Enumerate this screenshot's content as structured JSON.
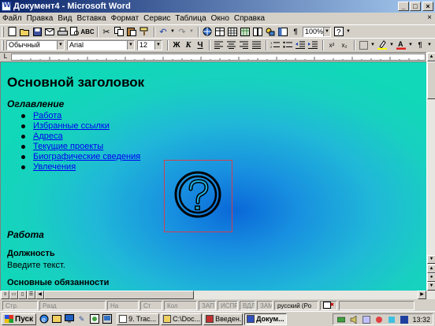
{
  "window": {
    "title": "Документ4 - Microsoft Word"
  },
  "menu": [
    "Файл",
    "Правка",
    "Вид",
    "Вставка",
    "Формат",
    "Сервис",
    "Таблица",
    "Окно",
    "Справка"
  ],
  "toolbar1": {
    "zoom": "100%"
  },
  "toolbar2": {
    "style": "Обычный",
    "font": "Arial",
    "size": "12",
    "bold": "Ж",
    "italic": "К",
    "underline": "Ч"
  },
  "document": {
    "heading": "Основной заголовок",
    "toc_title": "Оглавление",
    "links": [
      "Работа",
      "Избранные ссылки",
      "Адреса",
      "Текущие проекты",
      "Биографические сведения",
      "Увлечения"
    ],
    "section_work": "Работа",
    "position_label": "Должность",
    "placeholder_text": "Введите текст.",
    "duties_label": "Основные обязанности"
  },
  "statusbar": {
    "cells": [
      "Стр.",
      "Разд",
      "На",
      "Ст",
      "Кол",
      "ЗАП",
      "ИСПР",
      "ВДЛ",
      "ЗАМ"
    ],
    "language": "русский (Ро"
  },
  "taskbar": {
    "start": "Пуск",
    "tasks": [
      "9. Trac...",
      "C:\\Doc...",
      "Введен...",
      "Докум..."
    ],
    "active_task": 3,
    "clock": "13:32"
  },
  "colors": {
    "title_gradient_start": "#0a246a",
    "title_gradient_end": "#a6caf0",
    "link": "#0000ee",
    "doc_bg_center": "#0a68d8",
    "doc_bg_edge": "#10d8b8"
  }
}
